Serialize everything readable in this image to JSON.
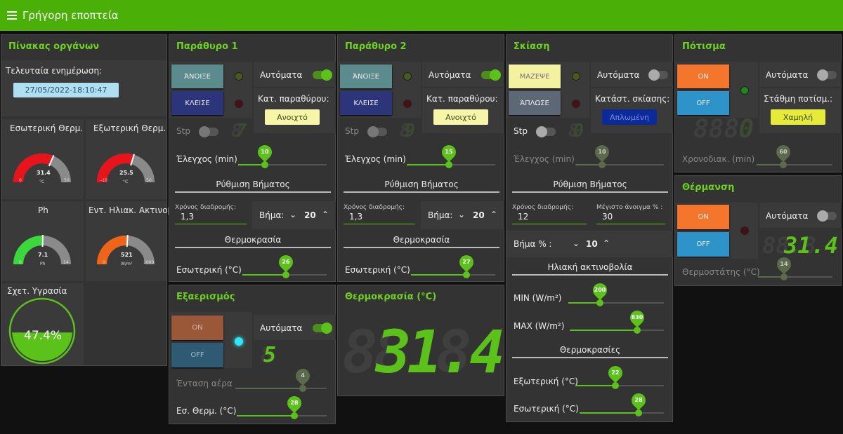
{
  "app": {
    "title": "Γρήγορη εποπτεία"
  },
  "dash": {
    "title": "Πίνακας οργάνων",
    "updated_label": "Τελευταία ενημέρωση:",
    "updated_value": "27/05/2022-18:10:47",
    "g1": {
      "label": "Εσωτερική Θερμ.",
      "value": "31.4",
      "unit": "°C",
      "min": "0",
      "max": "50",
      "fraction": 0.628,
      "color": "#e8141a"
    },
    "g2": {
      "label": "Εξωτερική Θερμ.",
      "value": "25.5",
      "unit": "°C",
      "min": "-10",
      "max": "50",
      "fraction": 0.592,
      "color": "#e8141a"
    },
    "g3": {
      "label": "Ph",
      "value": "7.1",
      "unit": "Ph",
      "min": "0",
      "max": "14",
      "fraction": 0.507,
      "color": "#3ad83a"
    },
    "g4": {
      "label": "Εντ. Ηλιακ. Ακτινοβ.",
      "value": "521",
      "unit": "W/m²",
      "min": "0",
      "max": "1000",
      "fraction": 0.521,
      "color": "#f06418"
    },
    "humidity": {
      "label": "Σχετ. Υγρασία",
      "value": "47.4%",
      "level": 0.474
    }
  },
  "w1": {
    "title": "Παράθυρο 1",
    "open": "ΆΝΟΙΞΕ",
    "close": "ΚΛΕΙΣΕ",
    "auto": "Αυτόματα",
    "state_label": "Κατ. παραθύρου:",
    "state": "Ανοιχτό",
    "stp": "Stp",
    "seg": "7",
    "ctrl_label": "Έλεγχος (min)",
    "ctrl": 10,
    "ctrl_frac": 0.3,
    "step_section": "Ρύθμιση Βήματος",
    "travel_label": "Χρόνος διαδρομής:",
    "travel": "1,3",
    "step_label": "Βήμα:",
    "step": "20",
    "temp_section": "Θερμοκρασία",
    "inner_label": "Εσωτερική (°C)",
    "inner": 26,
    "inner_frac": 0.52
  },
  "w2": {
    "title": "Παράθυρο 2",
    "open": "ΆΝΟΙΞΕ",
    "close": "ΚΛΕΙΣΕ",
    "auto": "Αυτόματα",
    "state_label": "Κατ. παραθύρου:",
    "state": "Ανοιχτό",
    "stp": "Stp",
    "seg": "9",
    "ctrl_label": "Έλεγχος (min)",
    "ctrl": 15,
    "ctrl_frac": 0.48,
    "step_section": "Ρύθμιση Βήματος",
    "travel_label": "Χρόνος διαδρομής:",
    "travel": "1,3",
    "step_label": "Βήμα:",
    "step": "20",
    "temp_section": "Θερμοκρασία",
    "inner_label": "Εσωτερική (°C)",
    "inner": 27,
    "inner_frac": 0.66
  },
  "shade": {
    "title": "Σκίαση",
    "gather": "ΜΑΖΕΨΕ",
    "spread": "ΆΠΛΩΣΕ",
    "auto": "Αυτόματα",
    "state_label": "Κατάστ. σκίασης:",
    "state": "Απλωμένη",
    "stp": "Stp",
    "seg": "0",
    "ctrl_label": "Έλεγχος (min)",
    "ctrl": 10,
    "ctrl_frac": 0.3,
    "step_section": "Ρύθμιση Βήματος",
    "travel_label": "Χρόνος διαδρομής:",
    "travel": "12",
    "maxopen_label": "Μέγιστο άνοιγμα % :",
    "maxopen": "30",
    "steppct_label": "Βήμα % :",
    "steppct": "10",
    "solar_section": "Ηλιακή ακτινοβολία",
    "min_label": "MIN (W/m²)",
    "min": 200,
    "min_frac": 0.33,
    "max_label": "MAX (W/m²)",
    "max": 830,
    "max_frac": 0.72,
    "temps_section": "Θερμοκρασίες",
    "outer_label": "Εξωτερική (°C)",
    "outer": 22,
    "outer_frac": 0.45,
    "inner_label": "Εσωτερική (°C)",
    "inner": 28,
    "inner_frac": 0.7
  },
  "water": {
    "title": "Πότισμα",
    "on": "ON",
    "off": "OFF",
    "auto": "Αυτόματα",
    "level_label": "Στάθμη ποτίσμ.:",
    "level": "Χαμηλή",
    "seg": "0",
    "timer_label": "Χρονοδιακ. (min)",
    "timer": 60,
    "timer_frac": 0.35
  },
  "heat": {
    "title": "Θέρμανση",
    "on": "ON",
    "off": "OFF",
    "auto": "Αυτόματα",
    "seg": "31.4",
    "thermo_label": "Θερμοστάτης (°C)",
    "thermo": 14,
    "thermo_frac": 0.35
  },
  "vent": {
    "title": "Εξαερισμός",
    "on": "ON",
    "off": "OFF",
    "auto": "Αυτόματα",
    "seg": "5",
    "air_label": "Ένταση αέρα",
    "air": 4,
    "air_frac": 0.74,
    "temp_label": "Εσ. Θερμ. (°C)",
    "temp": 28,
    "temp_frac": 0.64
  },
  "tbig": {
    "title": "Θερμοκρασία (°C)",
    "value": "31.4"
  },
  "colors": {
    "accent": "#4ab008",
    "green": "#5bc21a",
    "on_orange": "#f4762c",
    "off_blue": "#2e93c9"
  }
}
